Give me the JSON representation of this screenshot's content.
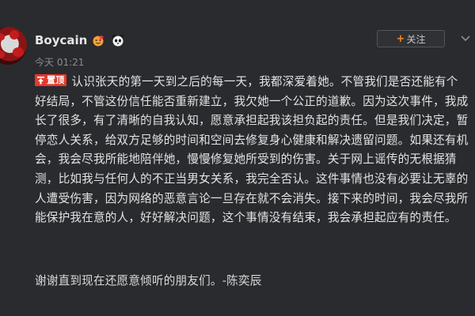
{
  "post": {
    "username": "Boycain",
    "timestamp": "今天 01:21",
    "follow_label": "关注",
    "follow_plus": "+",
    "pin_label": "置顶",
    "body": "认识张天的第一天到之后的每一天，我都深爱着她。不管我们是否还能有个好结局，不管这份信任能否重新建立，我欠她一个公正的道歉。因为这次事件，我成长了很多，有了清晰的自我认知，愿意承担起我该担负起的责任。但是我们决定，暂停恋人关系，给双方足够的时间和空间去修复身心健康和解决遗留问题。如果还有机会，我会尽我所能地陪伴她，慢慢修复她所受到的伤害。关于网上谣传的无根据猜测，比如我与任何人的不正当男女关系，我完全否认。这件事情也没有必要让无辜的人遭受伤害，因为网络的恶意言论一旦存在就不会消失。接下来的时间，我会尽我所能保护我在意的人，好好解决问题，这个事情没有结束，我会承担起应有的责任。",
    "sign_off": "谢谢直到现在还愿意倾听的朋友们。-陈奕辰"
  },
  "icons": {
    "badges": [
      "vip-face-icon",
      "panda-icon"
    ],
    "pin": "pin-icon",
    "menu": "chevron-down-icon"
  },
  "colors": {
    "background": "#2a2b2f",
    "text": "#e3e3e3",
    "muted": "#8b8c90",
    "pin_red": "#e5392d",
    "accent_orange": "#f08a24"
  }
}
